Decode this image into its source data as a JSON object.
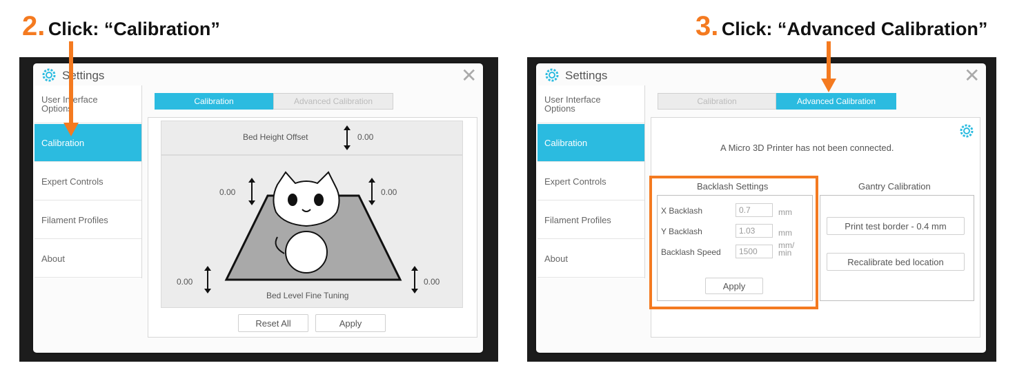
{
  "step2": {
    "number": "2.",
    "text": "Click: “Calibration”"
  },
  "step3": {
    "number": "3.",
    "text": "Click: “Advanced Calibration”"
  },
  "left": {
    "title": "Settings",
    "close": "✕",
    "sidebar": [
      {
        "label": "User Interface Options",
        "active": false
      },
      {
        "label": "Calibration",
        "active": true
      },
      {
        "label": "Expert Controls",
        "active": false
      },
      {
        "label": "Filament Profiles",
        "active": false
      },
      {
        "label": "About",
        "active": false
      }
    ],
    "tabs": {
      "calibration": "Calibration",
      "advanced": "Advanced Calibration"
    },
    "bed_height_offset": {
      "label": "Bed Height Offset",
      "value": "0.00"
    },
    "corners": {
      "top_left": "0.00",
      "top_right": "0.00",
      "bottom_left": "0.00",
      "bottom_right": "0.00"
    },
    "fine_tuning_label": "Bed Level Fine Tuning",
    "reset_all": "Reset All",
    "apply": "Apply"
  },
  "right": {
    "title": "Settings",
    "close": "✕",
    "sidebar": [
      {
        "label": "User Interface Options",
        "active": false
      },
      {
        "label": "Calibration",
        "active": true
      },
      {
        "label": "Expert Controls",
        "active": false
      },
      {
        "label": "Filament Profiles",
        "active": false
      },
      {
        "label": "About",
        "active": false
      }
    ],
    "tabs": {
      "calibration": "Calibration",
      "advanced": "Advanced Calibration"
    },
    "not_connected": "A Micro 3D Printer has not been connected.",
    "backlash": {
      "heading": "Backlash Settings",
      "x_label": "X Backlash",
      "x_value": "0.7",
      "x_unit": "mm",
      "y_label": "Y Backlash",
      "y_value": "1.03",
      "y_unit": "mm",
      "speed_label": "Backlash Speed",
      "speed_value": "1500",
      "speed_unit": "mm/ min",
      "apply": "Apply"
    },
    "gantry": {
      "heading": "Gantry Calibration",
      "print_border": "Print test border - 0.4 mm",
      "recalibrate": "Recalibrate bed location"
    }
  },
  "colors": {
    "accent": "#2bbbe0",
    "callout": "#f47a20"
  }
}
